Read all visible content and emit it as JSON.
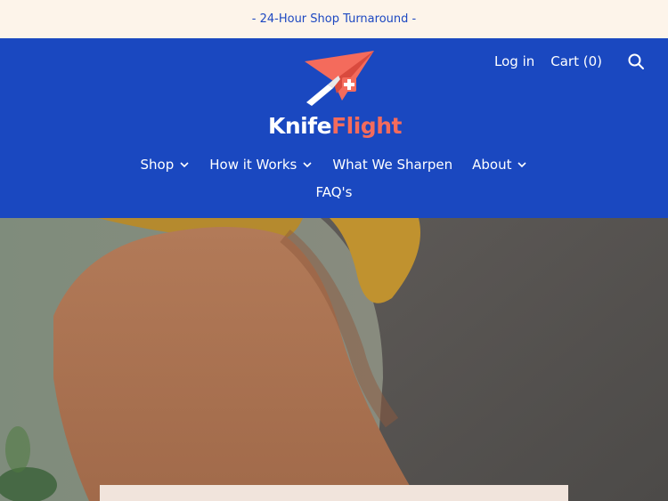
{
  "announcement": {
    "text": "- 24-Hour Shop Turnaround -"
  },
  "header": {
    "login_label": "Log in",
    "cart_label": "Cart (0)",
    "brand_part1": "Knife",
    "brand_part2": "Flight",
    "colors": {
      "primary": "#1a48c0",
      "accent": "#f46b5c",
      "announcement_bg": "#fdf4ea"
    }
  },
  "nav": {
    "items": [
      {
        "label": "Shop",
        "icon": "chevron-down-icon"
      },
      {
        "label": "How it Works",
        "icon": "chevron-down-icon"
      },
      {
        "label": "What We Sharpen"
      },
      {
        "label": "About",
        "icon": "chevron-down-icon"
      },
      {
        "label": "FAQ's"
      }
    ]
  }
}
